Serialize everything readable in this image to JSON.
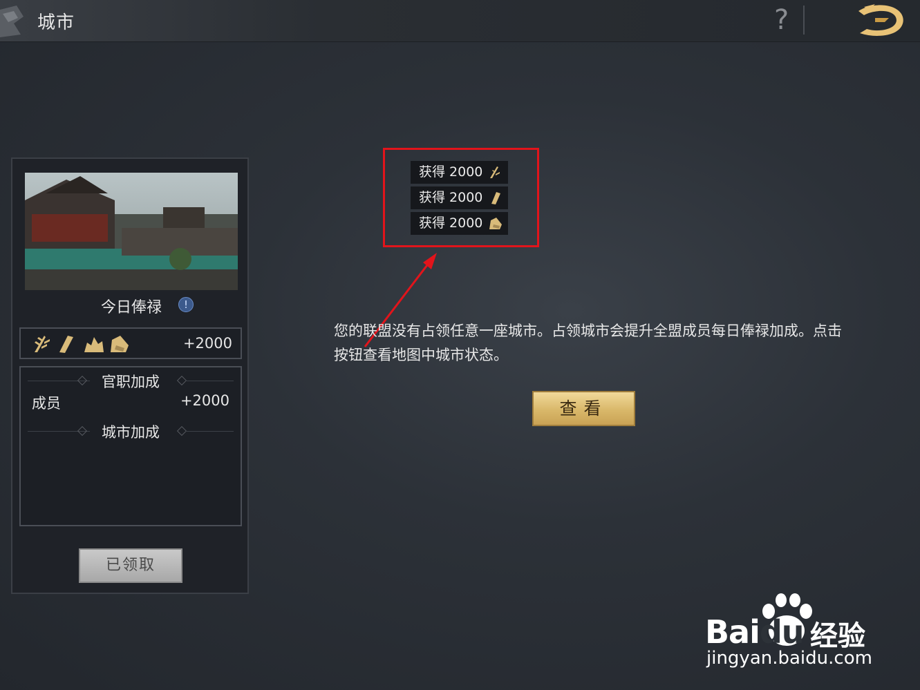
{
  "header": {
    "title": "城市",
    "help_icon": "?"
  },
  "left_panel": {
    "salary_title": "今日俸禄",
    "info_icon": "!",
    "resource_total": "+2000",
    "resource_icons": [
      "grain-icon",
      "wood-icon",
      "stone-icon",
      "iron-icon"
    ],
    "bonus": {
      "official_title": "官职加成",
      "member_label": "成员",
      "member_value": "+2000",
      "city_title": "城市加成"
    },
    "claimed_button": "已领取"
  },
  "rewards": [
    {
      "text": "获得 2000",
      "icon": "grain-icon"
    },
    {
      "text": "获得 2000",
      "icon": "wood-icon"
    },
    {
      "text": "获得 2000",
      "icon": "iron-icon"
    }
  ],
  "main": {
    "message": "您的联盟没有占领任意一座城市。占领城市会提升全盟成员每日俸禄加成。点击按钮查看地图中城市状态。",
    "view_button": "查看"
  },
  "watermark": {
    "brand": "Bai",
    "brand_mid": "du",
    "cn": "经验",
    "url": "jingyan.baidu.com"
  },
  "colors": {
    "accent_gold": "#d9b86a",
    "highlight_red": "#e2141b"
  }
}
